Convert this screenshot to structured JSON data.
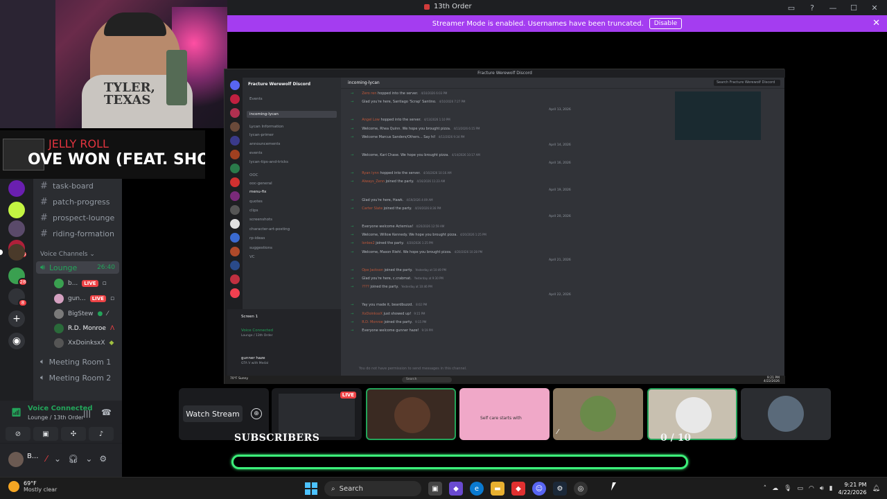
{
  "window": {
    "title": "13th Order"
  },
  "banner": {
    "message": "Streamer Mode is enabled. Usernames have been truncated.",
    "button": "Disable"
  },
  "webcam": {
    "shirt_line1": "TYLER,",
    "shirt_line2": "TEXAS"
  },
  "now_playing": {
    "artist": "JELLY ROLL",
    "song": "OVE WON (FEAT. SHOO"
  },
  "servers": {
    "badges": [
      "15",
      "28",
      "8"
    ]
  },
  "channels": {
    "text": [
      "task-board",
      "patch-progress",
      "prospect-lounge",
      "riding-formation"
    ],
    "voice_header": "Voice Channels",
    "lounge": {
      "name": "Lounge",
      "timer": "26:40"
    },
    "voice_users": [
      {
        "name": "b...",
        "live": "LIVE"
      },
      {
        "name": "gun...",
        "live": "LIVE"
      },
      {
        "name": "BigStew"
      },
      {
        "name": "R.D. Monroe"
      },
      {
        "name": "XxDoinksxX"
      }
    ],
    "meeting_rooms": [
      "Meeting Room 1",
      "Meeting Room 2"
    ]
  },
  "voice_panel": {
    "status": "Voice Connected",
    "location": "Lounge / 13th Order"
  },
  "user_panel": {
    "name": "B..."
  },
  "stream": {
    "window_title": "Fracture Werewolf Discord",
    "server_name": "Fracture Werewolf Discord",
    "channel": "incoming-lycan",
    "search": "Search Fracture Werewolf Discord",
    "side_channels": [
      "Events",
      "incoming-lycan",
      "Lycan Information",
      "lycan-primer",
      "announcements",
      "events",
      "lycan-tips-and-tricks",
      "OOC",
      "ooc-general",
      "menu-fix",
      "quotes",
      "clips",
      "screenshots",
      "character-art-posting",
      "rp-ideas",
      "suggestions",
      "VC"
    ],
    "messages": [
      {
        "user": "Zero ren",
        "text": "hopped into the server.",
        "time": "4/10/2026 6:03 PM"
      },
      {
        "user": "",
        "text": "Glad you're here, Santiago 'Scrap' Santino.",
        "time": "4/10/2026 7:27 PM"
      },
      {
        "date": "April 13, 2026"
      },
      {
        "user": "Angel Low",
        "text": "hopped into the server.",
        "time": "4/13/2026 1:10 PM"
      },
      {
        "user": "",
        "text": "Welcome, Rhea Quinn. We hope you brought pizza.",
        "time": "4/13/2026 6:15 PM"
      },
      {
        "user": "",
        "text": "Welcome Marcus Sanders/Others... Say hi!",
        "time": "4/13/2026 9:34 PM"
      },
      {
        "date": "April 14, 2026"
      },
      {
        "user": "",
        "text": "Welcome, Kari Chase. We hope you brought pizza.",
        "time": "4/14/2026 10:17 AM"
      },
      {
        "date": "April 16, 2026"
      },
      {
        "user": "Ryan lynn",
        "text": "hopped into the server.",
        "time": "4/16/2026 10:16 AM"
      },
      {
        "user": "Always_Zenn",
        "text": "joined the party.",
        "time": "4/16/2026 11:23 AM"
      },
      {
        "date": "April 19, 2026"
      },
      {
        "user": "",
        "text": "Glad you're here, Hawk.",
        "time": "4/19/2026 4:09 AM"
      },
      {
        "user": "Carter Slate",
        "text": "joined the party.",
        "time": "4/19/2026 8:36 PM"
      },
      {
        "date": "April 20, 2026"
      },
      {
        "user": "",
        "text": "Everyone welcome Actemius!",
        "time": "4/20/2026 12:59 AM"
      },
      {
        "user": "",
        "text": "Welcome, Willow Kennedy. We hope you brought pizza.",
        "time": "4/20/2026 1:25 PM"
      },
      {
        "user": "Ionlee2",
        "text": "joined the party.",
        "time": "4/20/2026 1:25 PM"
      },
      {
        "user": "",
        "text": "Welcome, Mason Riehl. We hope you brought pizza.",
        "time": "4/20/2026 10:28 PM"
      },
      {
        "date": "April 21, 2026"
      },
      {
        "user": "Ope Jackson",
        "text": "joined the party.",
        "time": "Yesterday at 10:49 PM"
      },
      {
        "user": "",
        "text": "Glad you're here, c.crabmat.",
        "time": "Yesterday at 9:30 PM"
      },
      {
        "user": "????",
        "text": "joined the party.",
        "time": "Yesterday at 10:46 PM"
      },
      {
        "date": "April 22, 2026"
      },
      {
        "user": "",
        "text": "Yay you made it, beardbuzzd.",
        "time": "8:02 PM"
      },
      {
        "user": "XxDoinksxX",
        "text": "just showed up!",
        "time": "9:15 PM"
      },
      {
        "user": "R.D. Monroe",
        "text": "joined the party.",
        "time": "9:15 PM"
      },
      {
        "user": "",
        "text": "Everyone welcome gunner haze!",
        "time": "9:19 PM"
      }
    ],
    "input_placeholder": "You do not have permission to send messages in this channel.",
    "screen_label": "Screen 1",
    "voice_status": "Voice Connected",
    "voice_location": "Lounge / 13th Order",
    "user": "gunner haze",
    "user_status": "GTA V with Medal",
    "taskbar_search": "Search",
    "clock_time": "9:21 PM",
    "clock_date": "4/22/2026",
    "weather": "70°F Sunny"
  },
  "thumbnails": {
    "watch_label": "Watch Stream",
    "live": "LIVE",
    "tile4_text": "Self care starts with"
  },
  "overlay": {
    "subscribers_label": "SUBSCRIBERS",
    "subscribers_count": "0 / 10",
    "progress_fraction": 0
  },
  "taskbar": {
    "temp": "69°F",
    "condition": "Mostly clear",
    "search": "Search",
    "time": "9:21 PM",
    "date": "4/22/2026"
  }
}
